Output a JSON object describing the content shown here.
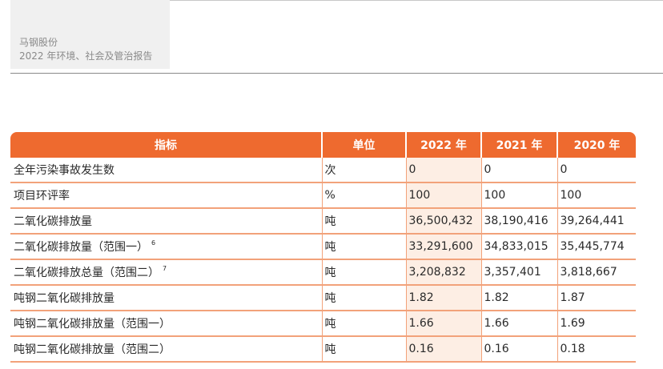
{
  "header": {
    "company": "马钢股份",
    "report_title": "2022 年环境、社会及管治报告"
  },
  "table": {
    "columns": [
      "指标",
      "单位",
      "2022 年",
      "2021 年",
      "2020 年"
    ],
    "rows": [
      {
        "indicator": "全年污染事故发生数",
        "footnote": "",
        "unit": "次",
        "y2022": "0",
        "y2021": "0",
        "y2020": "0"
      },
      {
        "indicator": "项目环评率",
        "footnote": "",
        "unit": "%",
        "y2022": "100",
        "y2021": "100",
        "y2020": "100"
      },
      {
        "indicator": "二氧化碳排放量",
        "footnote": "",
        "unit": "吨",
        "y2022": "36,500,432",
        "y2021": "38,190,416",
        "y2020": "39,264,441"
      },
      {
        "indicator": "二氧化碳排放量（范围一）",
        "footnote": "6",
        "unit": "吨",
        "y2022": "33,291,600",
        "y2021": "34,833,015",
        "y2020": "35,445,774"
      },
      {
        "indicator": "二氧化碳排放总量（范围二）",
        "footnote": "7",
        "unit": "吨",
        "y2022": "3,208,832",
        "y2021": "3,357,401",
        "y2020": "3,818,667"
      },
      {
        "indicator": "吨钢二氧化碳排放量",
        "footnote": "",
        "unit": "吨",
        "y2022": "1.82",
        "y2021": "1.82",
        "y2020": "1.87"
      },
      {
        "indicator": "吨钢二氧化碳排放量（范围一）",
        "footnote": "",
        "unit": "吨",
        "y2022": "1.66",
        "y2021": "1.66",
        "y2020": "1.69"
      },
      {
        "indicator": "吨钢二氧化碳排放量（范围二）",
        "footnote": "",
        "unit": "吨",
        "y2022": "0.16",
        "y2021": "0.16",
        "y2020": "0.18"
      }
    ]
  },
  "colors": {
    "header_bg": "#ee6a2f",
    "row_rule": "#f2a27a",
    "highlight_col": "#fdeee4"
  }
}
